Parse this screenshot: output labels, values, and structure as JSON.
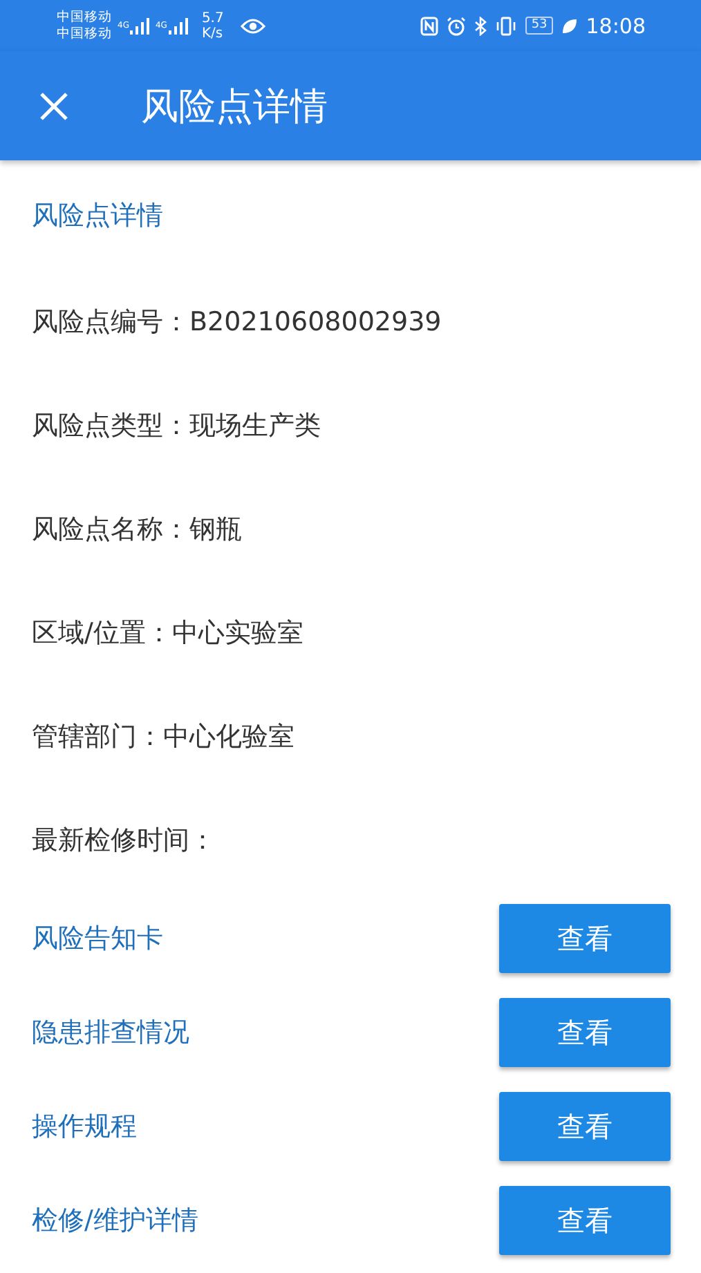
{
  "status_bar": {
    "carriers": [
      "中国移动",
      "中国移动"
    ],
    "network_labels": [
      "4G",
      "4G"
    ],
    "speed": [
      "5.7",
      "K/s"
    ],
    "battery": "53",
    "time": "18:08"
  },
  "app_bar": {
    "title": "风险点详情"
  },
  "section_title": "风险点详情",
  "fields": [
    {
      "label": "风险点编号：",
      "value": "B20210608002939"
    },
    {
      "label": "风险点类型：",
      "value": "现场生产类"
    },
    {
      "label": "风险点名称：",
      "value": "钢瓶"
    },
    {
      "label": "区域/位置：",
      "value": "中心实验室"
    },
    {
      "label": "管辖部门：",
      "value": "中心化验室"
    },
    {
      "label": "最新检修时间："
    }
  ],
  "links": [
    {
      "label": "风险告知卡",
      "button": "查看"
    },
    {
      "label": "隐患排查情况",
      "button": "查看"
    },
    {
      "label": "操作规程",
      "button": "查看"
    },
    {
      "label": "检修/维护详情",
      "button": "查看"
    }
  ]
}
